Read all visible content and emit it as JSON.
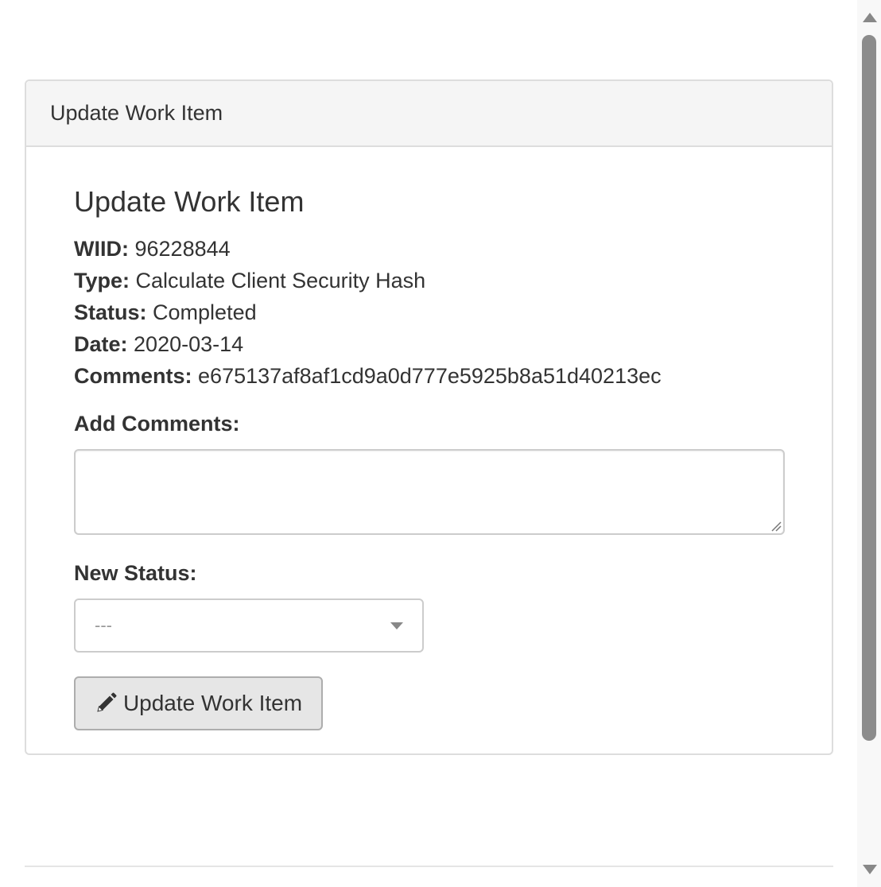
{
  "panel": {
    "heading": "Update Work Item"
  },
  "form": {
    "title": "Update Work Item",
    "details": {
      "wiid_label": "WIID:",
      "wiid_value": "96228844",
      "type_label": "Type:",
      "type_value": "Calculate Client Security Hash",
      "status_label": "Status:",
      "status_value": "Completed",
      "date_label": "Date:",
      "date_value": "2020-03-14",
      "comments_label": "Comments:",
      "comments_value": "e675137af8af1cd9a0d777e5925b8a51d40213ec"
    },
    "add_comments_label": "Add Comments:",
    "add_comments_value": "",
    "new_status_label": "New Status:",
    "new_status_selected": "---",
    "submit_label": "Update Work Item",
    "submit_icon": "pencil-icon"
  },
  "colors": {
    "panel_heading_bg": "#f5f5f5",
    "border": "#dddddd",
    "button_bg": "#e6e6e6",
    "text": "#333333"
  }
}
